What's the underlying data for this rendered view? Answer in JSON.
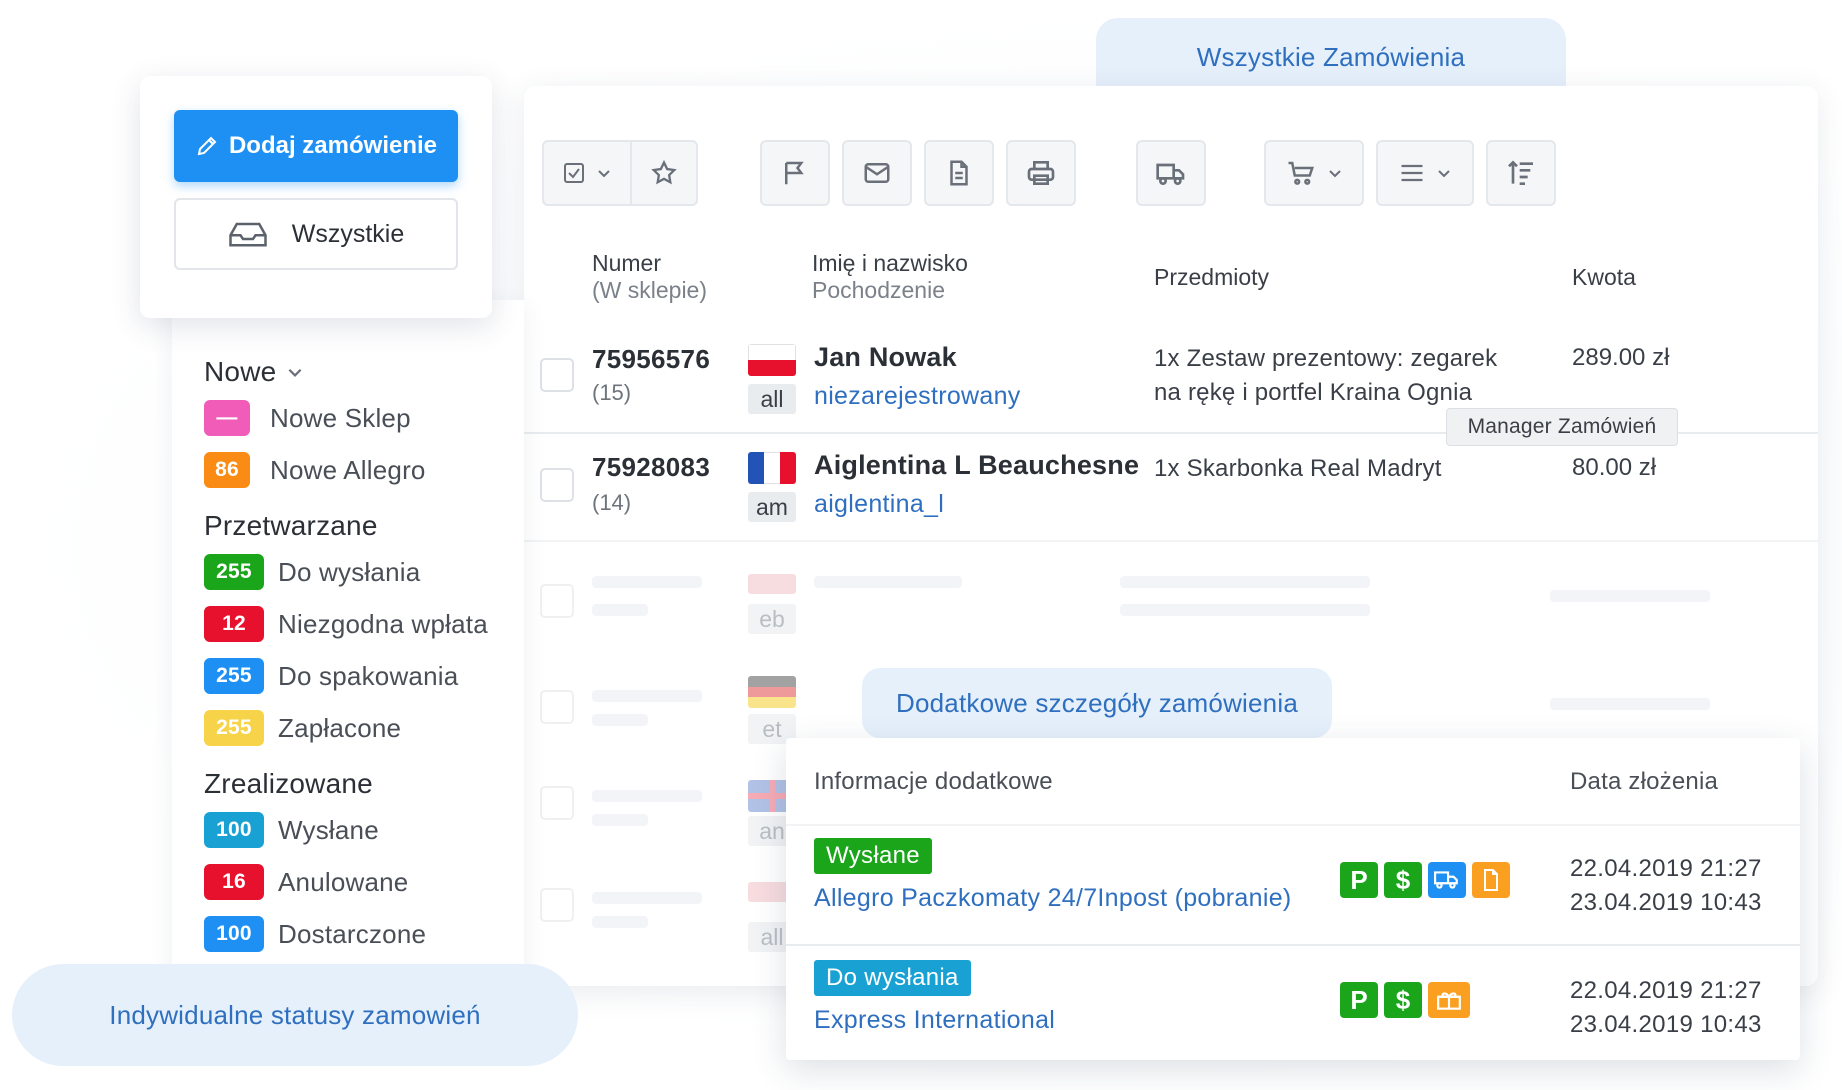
{
  "callouts": {
    "all_orders": "Wszystkie Zamówienia",
    "individual_statuses": "Indywidualne statusy zamowień",
    "order_details": "Dodatkowe szczegóły zamówienia"
  },
  "sidebar": {
    "add_order_label": "Dodaj zamówienie",
    "all_label": "Wszystkie",
    "groups": {
      "new": {
        "title": "Nowe",
        "items": [
          {
            "count": "—",
            "label": "Nowe Sklep",
            "color": "#f05cb7"
          },
          {
            "count": "86",
            "label": "Nowe Allegro",
            "color": "#fa8c16"
          }
        ]
      },
      "processing": {
        "title": "Przetwarzane",
        "items": [
          {
            "count": "255",
            "label": "Do wysłania",
            "color": "#1aa51a"
          },
          {
            "count": "12",
            "label": "Niezgodna wpłata",
            "color": "#e8112d"
          },
          {
            "count": "255",
            "label": "Do spakowania",
            "color": "#1e90f3"
          },
          {
            "count": "255",
            "label": "Zapłacone",
            "color": "#f7d34a"
          }
        ]
      },
      "done": {
        "title": "Zrealizowane",
        "items": [
          {
            "count": "100",
            "label": "Wysłane",
            "color": "#1aa1d4"
          },
          {
            "count": "16",
            "label": "Anulowane",
            "color": "#e8112d"
          },
          {
            "count": "100",
            "label": "Dostarczone",
            "color": "#1e90f3"
          }
        ]
      }
    }
  },
  "table": {
    "headers": {
      "number": "Numer",
      "number_sub": "(W sklepie)",
      "name": "Imię i nazwisko",
      "name_sub": "Pochodzenie",
      "items": "Przedmioty",
      "amount": "Kwota"
    },
    "rows": [
      {
        "number": "75956576",
        "count": "(15)",
        "flag": "pl",
        "source": "all",
        "name": "Jan Nowak",
        "login": "niezarejestrowany",
        "items_line1": "1x Zestaw prezentowy: zegarek",
        "items_line2": "na rękę i portfel Kraina Ognia",
        "amount": "289.00 zł"
      },
      {
        "number": "75928083",
        "count": "(14)",
        "flag": "fr",
        "source": "am",
        "name": "Aiglentina L Beauchesne",
        "login": "aiglentina_l",
        "items_line1": "1x Skarbonka Real Madryt",
        "amount": "80.00 zł"
      }
    ],
    "ghost_sources": [
      "eb",
      "et",
      "an",
      "all"
    ],
    "tooltip": "Manager Zamówień"
  },
  "toolbar": {
    "icons": [
      "checkbox-icon",
      "star-icon",
      "flag-icon",
      "mail-icon",
      "document-icon",
      "printer-icon",
      "truck-icon",
      "cart-icon",
      "menu-icon",
      "sort-icon"
    ]
  },
  "details": {
    "headers": {
      "info": "Informacje dodatkowe",
      "date": "Data złożenia"
    },
    "rows": [
      {
        "status": "Wysłane",
        "status_color": "#1aa51a",
        "shipping": "Allegro Paczkomaty 24/7Inpost (pobranie)",
        "date1": "22.04.2019 21:27",
        "date2": "23.04.2019 10:43"
      },
      {
        "status": "Do wysłania",
        "status_color": "#1aa1d4",
        "shipping": "Express International",
        "date1": "22.04.2019 21:27",
        "date2": "23.04.2019 10:43"
      }
    ],
    "icon_p": "P",
    "icon_dollar": "$"
  }
}
